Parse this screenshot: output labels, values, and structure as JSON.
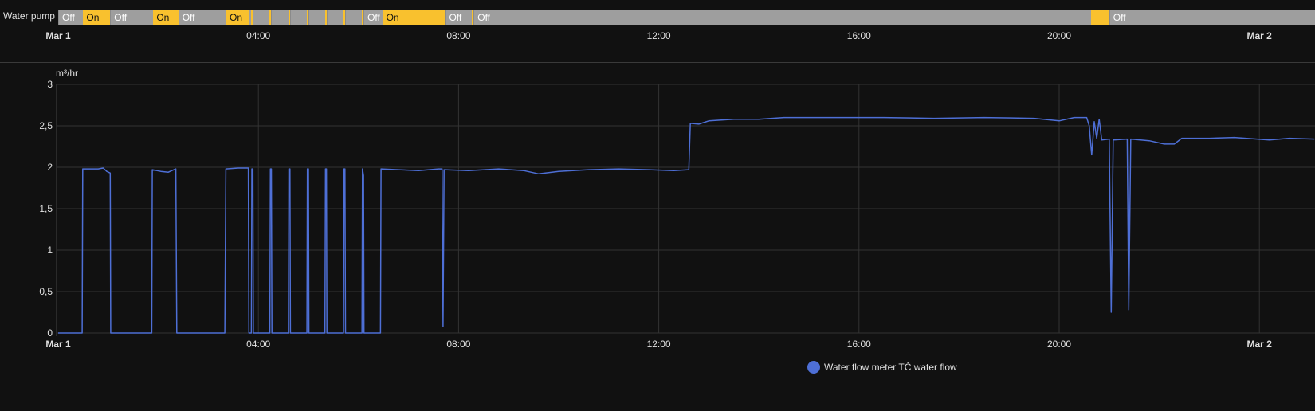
{
  "timeline": {
    "entity_label": "Water pump",
    "colors": {
      "on": "#f9c12e",
      "off": "#9e9e9e"
    },
    "segments": [
      {
        "state": "Off",
        "start": 0,
        "end": 0.5
      },
      {
        "state": "On",
        "start": 0.5,
        "end": 1.04
      },
      {
        "state": "Off",
        "start": 1.04,
        "end": 1.9
      },
      {
        "state": "On",
        "start": 1.9,
        "end": 2.4
      },
      {
        "state": "Off",
        "start": 2.4,
        "end": 3.36
      },
      {
        "state": "On",
        "start": 3.36,
        "end": 3.8
      },
      {
        "state": "Off",
        "start": 3.8,
        "end": 3.85
      },
      {
        "state": "On",
        "start": 3.85,
        "end": 3.88
      },
      {
        "state": "Off",
        "start": 3.88,
        "end": 4.22
      },
      {
        "state": "On",
        "start": 4.22,
        "end": 4.25
      },
      {
        "state": "Off",
        "start": 4.25,
        "end": 4.6
      },
      {
        "state": "On",
        "start": 4.6,
        "end": 4.63
      },
      {
        "state": "Off",
        "start": 4.63,
        "end": 4.97
      },
      {
        "state": "On",
        "start": 4.97,
        "end": 5.0
      },
      {
        "state": "Off",
        "start": 5.0,
        "end": 5.33
      },
      {
        "state": "On",
        "start": 5.33,
        "end": 5.36
      },
      {
        "state": "Off",
        "start": 5.36,
        "end": 5.7
      },
      {
        "state": "On",
        "start": 5.7,
        "end": 5.73
      },
      {
        "state": "Off",
        "start": 5.73,
        "end": 6.07
      },
      {
        "state": "On",
        "start": 6.07,
        "end": 6.1
      },
      {
        "state": "Off",
        "start": 6.1,
        "end": 6.49
      },
      {
        "state": "On",
        "start": 6.49,
        "end": 7.73
      },
      {
        "state": "Off",
        "start": 7.73,
        "end": 8.27
      },
      {
        "state": "On",
        "start": 8.27,
        "end": 8.3
      },
      {
        "state": "Off",
        "start": 8.3,
        "end": 20.64
      },
      {
        "state": "On",
        "start": 20.64,
        "end": 21.0
      },
      {
        "state": "Off",
        "start": 21.0,
        "end": 25.2
      }
    ],
    "ticks": [
      {
        "h": 0,
        "label": "Mar 1",
        "bold": true
      },
      {
        "h": 4,
        "label": "04:00"
      },
      {
        "h": 8,
        "label": "08:00"
      },
      {
        "h": 12,
        "label": "12:00"
      },
      {
        "h": 16,
        "label": "16:00"
      },
      {
        "h": 20,
        "label": "20:00"
      },
      {
        "h": 24,
        "label": "Mar 2",
        "bold": true
      }
    ]
  },
  "chart_data": {
    "type": "line",
    "unit_label": "m³/hr",
    "ylim": [
      0,
      3
    ],
    "xlim_hours": [
      0,
      25.1
    ],
    "y_ticks": [
      {
        "v": 0,
        "label": "0"
      },
      {
        "v": 0.5,
        "label": "0,5"
      },
      {
        "v": 1,
        "label": "1"
      },
      {
        "v": 1.5,
        "label": "1,5"
      },
      {
        "v": 2,
        "label": "2"
      },
      {
        "v": 2.5,
        "label": "2,5"
      },
      {
        "v": 3,
        "label": "3"
      }
    ],
    "x_ticks": [
      {
        "h": 0,
        "label": "Mar 1",
        "bold": true
      },
      {
        "h": 4,
        "label": "04:00"
      },
      {
        "h": 8,
        "label": "08:00"
      },
      {
        "h": 12,
        "label": "12:00"
      },
      {
        "h": 16,
        "label": "16:00"
      },
      {
        "h": 20,
        "label": "20:00"
      },
      {
        "h": 24,
        "label": "Mar 2",
        "bold": true
      }
    ],
    "grid": true,
    "legend_position": "bottom-center",
    "series": [
      {
        "name": "Water flow meter TČ water flow",
        "color": "#4e6fd6",
        "points": [
          [
            0,
            0
          ],
          [
            0.48,
            0
          ],
          [
            0.49,
            1.98
          ],
          [
            0.8,
            1.98
          ],
          [
            0.9,
            1.99
          ],
          [
            0.97,
            1.95
          ],
          [
            1.04,
            1.93
          ],
          [
            1.05,
            0
          ],
          [
            1.87,
            0
          ],
          [
            1.88,
            1.97
          ],
          [
            2.05,
            1.95
          ],
          [
            2.2,
            1.94
          ],
          [
            2.35,
            1.98
          ],
          [
            2.37,
            0
          ],
          [
            3.33,
            0
          ],
          [
            3.35,
            1.98
          ],
          [
            3.6,
            1.99
          ],
          [
            3.8,
            1.99
          ],
          [
            3.81,
            0
          ],
          [
            3.86,
            0
          ],
          [
            3.87,
            1.98
          ],
          [
            3.89,
            1.98
          ],
          [
            3.9,
            0
          ],
          [
            4.23,
            0
          ],
          [
            4.24,
            1.98
          ],
          [
            4.26,
            1.98
          ],
          [
            4.27,
            0
          ],
          [
            4.6,
            0
          ],
          [
            4.61,
            1.98
          ],
          [
            4.63,
            1.98
          ],
          [
            4.64,
            0
          ],
          [
            4.97,
            0
          ],
          [
            4.98,
            1.98
          ],
          [
            5.0,
            1.98
          ],
          [
            5.01,
            0
          ],
          [
            5.33,
            0
          ],
          [
            5.34,
            1.98
          ],
          [
            5.36,
            1.98
          ],
          [
            5.37,
            0
          ],
          [
            5.7,
            0
          ],
          [
            5.71,
            1.98
          ],
          [
            5.73,
            1.98
          ],
          [
            5.74,
            0
          ],
          [
            6.07,
            0
          ],
          [
            6.08,
            1.98
          ],
          [
            6.1,
            1.9
          ],
          [
            6.11,
            0
          ],
          [
            6.44,
            0
          ],
          [
            6.45,
            1.98
          ],
          [
            6.8,
            1.97
          ],
          [
            7.2,
            1.96
          ],
          [
            7.6,
            1.98
          ],
          [
            7.67,
            1.98
          ],
          [
            7.69,
            0.08
          ],
          [
            7.71,
            1.97
          ],
          [
            8.2,
            1.96
          ],
          [
            8.8,
            1.98
          ],
          [
            9.3,
            1.96
          ],
          [
            9.6,
            1.92
          ],
          [
            10.0,
            1.95
          ],
          [
            10.6,
            1.97
          ],
          [
            11.2,
            1.98
          ],
          [
            11.8,
            1.97
          ],
          [
            12.3,
            1.96
          ],
          [
            12.6,
            1.97
          ],
          [
            12.63,
            2.53
          ],
          [
            12.8,
            2.52
          ],
          [
            13.0,
            2.56
          ],
          [
            13.5,
            2.58
          ],
          [
            14.0,
            2.58
          ],
          [
            14.5,
            2.6
          ],
          [
            15.5,
            2.6
          ],
          [
            16.5,
            2.6
          ],
          [
            17.5,
            2.59
          ],
          [
            18.5,
            2.6
          ],
          [
            19.5,
            2.59
          ],
          [
            20.0,
            2.56
          ],
          [
            20.3,
            2.6
          ],
          [
            20.55,
            2.6
          ],
          [
            20.6,
            2.5
          ],
          [
            20.65,
            2.15
          ],
          [
            20.7,
            2.55
          ],
          [
            20.75,
            2.35
          ],
          [
            20.8,
            2.58
          ],
          [
            20.85,
            2.33
          ],
          [
            21.0,
            2.34
          ],
          [
            21.04,
            0.25
          ],
          [
            21.08,
            2.33
          ],
          [
            21.36,
            2.34
          ],
          [
            21.39,
            0.28
          ],
          [
            21.43,
            2.34
          ],
          [
            21.8,
            2.32
          ],
          [
            22.1,
            2.28
          ],
          [
            22.3,
            2.28
          ],
          [
            22.45,
            2.35
          ],
          [
            23.0,
            2.35
          ],
          [
            23.5,
            2.36
          ],
          [
            24.2,
            2.33
          ],
          [
            24.6,
            2.35
          ],
          [
            25.1,
            2.34
          ]
        ]
      }
    ]
  }
}
